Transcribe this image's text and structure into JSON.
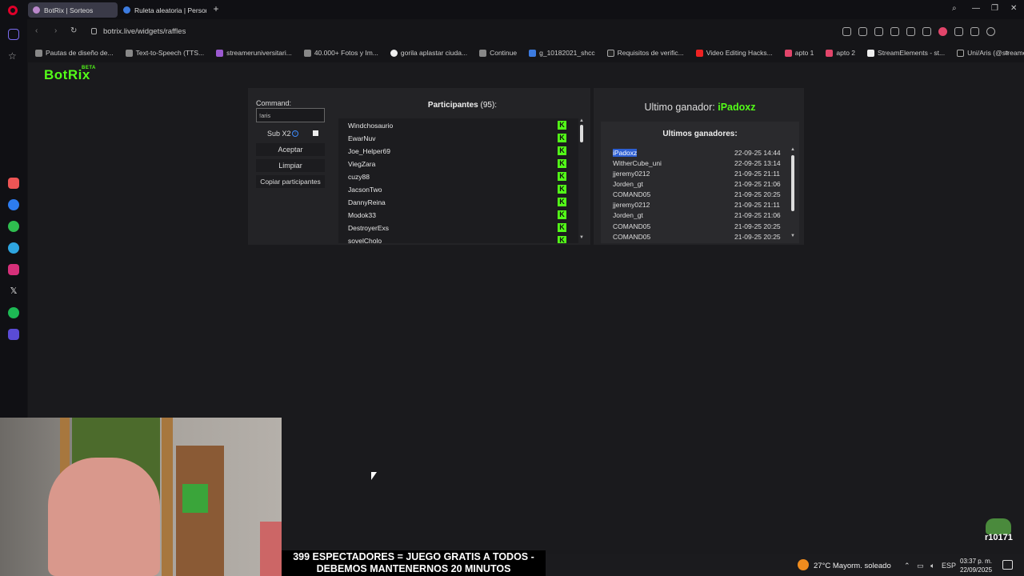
{
  "browser": {
    "tabs": [
      {
        "title": "BotRix | Sorteos"
      },
      {
        "title": "Ruleta aleatoria | Personal"
      }
    ],
    "url": "botrix.live/widgets/raffles",
    "bookmarks": [
      "Pautas de diseño de...",
      "Text-to-Speech (TTS...",
      "streameruniversitari...",
      "40.000+ Fotos y Im...",
      "gorila aplastar ciuda...",
      "Continue",
      "g_10182021_shcc",
      "Requisitos de verific...",
      "Video Editing Hacks...",
      "apto 1",
      "apto 2",
      "StreamElements - st...",
      "Uni/Aris (@streame..."
    ]
  },
  "brand": {
    "name": "BotRix",
    "tag": "BETA"
  },
  "controls": {
    "command_label": "Command:",
    "command_value": "!aris",
    "sub_label": "Sub X2",
    "accept": "Aceptar",
    "clear": "Limpiar",
    "copy": "Copiar participantes"
  },
  "participants": {
    "title": "Participantes",
    "count": "(95):",
    "names": [
      "Windchosaurio",
      "EwarNuv",
      "Joe_Helper69",
      "ViegZara",
      "cuzy88",
      "JacsonTwo",
      "DannyReina",
      "Modok33",
      "DestroyerExs",
      "sovelCholo"
    ],
    "platform_icon": "kick-icon"
  },
  "winner": {
    "label": "Ultimo ganador:",
    "name": "iPadoxz",
    "history_title": "Ultimos ganadores:",
    "history": [
      {
        "name": "iPadoxz",
        "date": "22-09-25 14:44"
      },
      {
        "name": "WitherCube_uni",
        "date": "22-09-25 13:14"
      },
      {
        "name": "jjeremy0212",
        "date": "21-09-25 21:11"
      },
      {
        "name": "Jorden_gt",
        "date": "21-09-25 21:06"
      },
      {
        "name": "COMAND05",
        "date": "21-09-25 20:25"
      },
      {
        "name": "jjeremy0212",
        "date": "21-09-25 21:11"
      },
      {
        "name": "Jorden_gt",
        "date": "21-09-25 21:06"
      },
      {
        "name": "COMAND05",
        "date": "21-09-25 20:25"
      },
      {
        "name": "COMAND05",
        "date": "21-09-25 20:25"
      }
    ]
  },
  "overlay": {
    "banner_line1": "399 ESPECTADORES = JUEGO GRATIS A TODOS -",
    "banner_line2": "DEBEMOS MANTENERNOS 20 MINUTOS",
    "logo_text": "r10171"
  },
  "taskbar": {
    "weather": "27°C  Mayorm. soleado",
    "lang": "ESP",
    "time": "03:37 p. m.",
    "date": "22/09/2025"
  },
  "colors": {
    "accent": "#53fc18",
    "selection": "#2d5fd3",
    "page_bg": "#1a1a1d"
  }
}
